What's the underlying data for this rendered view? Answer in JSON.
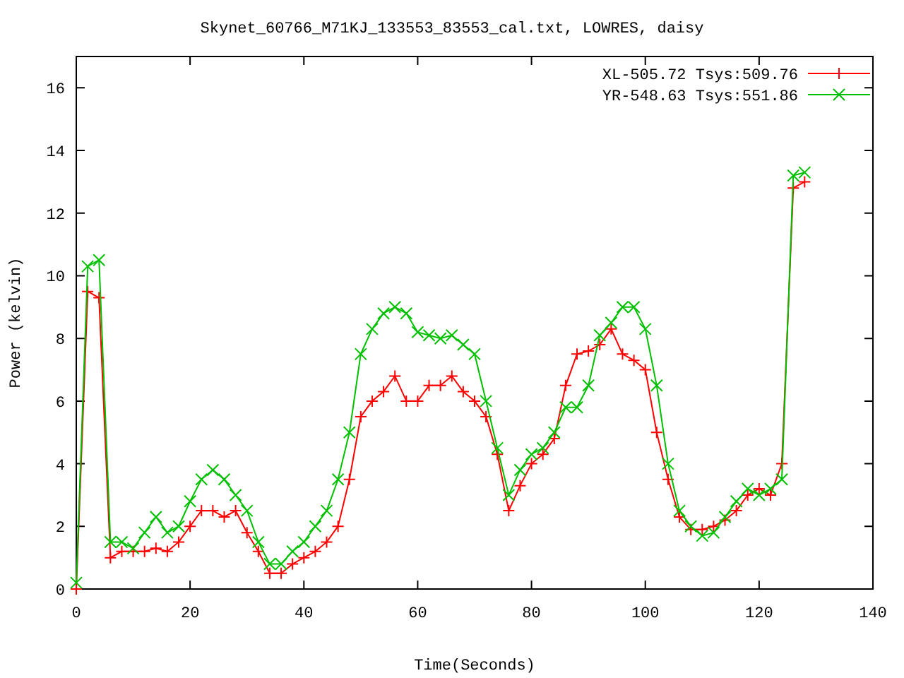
{
  "chart_data": {
    "type": "line",
    "title": "Skynet_60766_M71KJ_133553_83553_cal.txt, LOWRES, daisy",
    "xlabel": "Time(Seconds)",
    "ylabel": "Power (kelvin)",
    "x": [
      0,
      2,
      4,
      6,
      8,
      10,
      12,
      14,
      16,
      18,
      20,
      22,
      24,
      26,
      28,
      30,
      32,
      34,
      36,
      38,
      40,
      42,
      44,
      46,
      48,
      50,
      52,
      54,
      56,
      58,
      60,
      62,
      64,
      66,
      68,
      70,
      72,
      74,
      76,
      78,
      80,
      82,
      84,
      86,
      88,
      90,
      92,
      94,
      96,
      98,
      100,
      102,
      104,
      106,
      108,
      110,
      112,
      114,
      116,
      118,
      120,
      122,
      124,
      126,
      128
    ],
    "series": [
      {
        "name": "XL-505.72 Tsys:509.76",
        "color": "#ff0000",
        "marker": "plus",
        "values": [
          0,
          9.5,
          9.3,
          1,
          1.2,
          1.2,
          1.2,
          1.3,
          1.2,
          1.5,
          2,
          2.5,
          2.5,
          2.3,
          2.5,
          1.8,
          1.2,
          0.5,
          0.5,
          0.8,
          1,
          1.2,
          1.5,
          2,
          3.5,
          5.5,
          6,
          6.3,
          6.8,
          6,
          6,
          6.5,
          6.5,
          6.8,
          6.3,
          6,
          5.5,
          4.3,
          2.5,
          3.3,
          4,
          4.3,
          4.8,
          6.5,
          7.5,
          7.6,
          7.8,
          8.3,
          7.5,
          7.3,
          7,
          5,
          3.5,
          2.3,
          1.9,
          1.9,
          2,
          2.2,
          2.5,
          3,
          3.2,
          3,
          4,
          12.8,
          13
        ]
      },
      {
        "name": "YR-548.63 Tsys:551.86",
        "color": "#00c000",
        "marker": "cross",
        "values": [
          0.2,
          10.3,
          10.5,
          1.5,
          1.5,
          1.3,
          1.8,
          2.3,
          1.8,
          2,
          2.8,
          3.5,
          3.8,
          3.5,
          3,
          2.5,
          1.5,
          0.8,
          0.8,
          1.2,
          1.5,
          2,
          2.5,
          3.5,
          5,
          7.5,
          8.3,
          8.8,
          9,
          8.8,
          8.2,
          8.1,
          8,
          8.1,
          7.8,
          7.5,
          6,
          4.5,
          3,
          3.8,
          4.3,
          4.5,
          5,
          5.8,
          5.8,
          6.5,
          8.1,
          8.5,
          9,
          9,
          8.3,
          6.5,
          4,
          2.5,
          2,
          1.7,
          1.8,
          2.3,
          2.8,
          3.2,
          3,
          3.2,
          3.5,
          13.2,
          13.3
        ]
      }
    ],
    "legend": true,
    "xlim": [
      0,
      140
    ],
    "ylim": [
      0,
      17
    ],
    "xticks": [
      0,
      20,
      40,
      60,
      80,
      100,
      120,
      140
    ],
    "yticks": [
      0,
      2,
      4,
      6,
      8,
      10,
      12,
      14,
      16
    ]
  }
}
